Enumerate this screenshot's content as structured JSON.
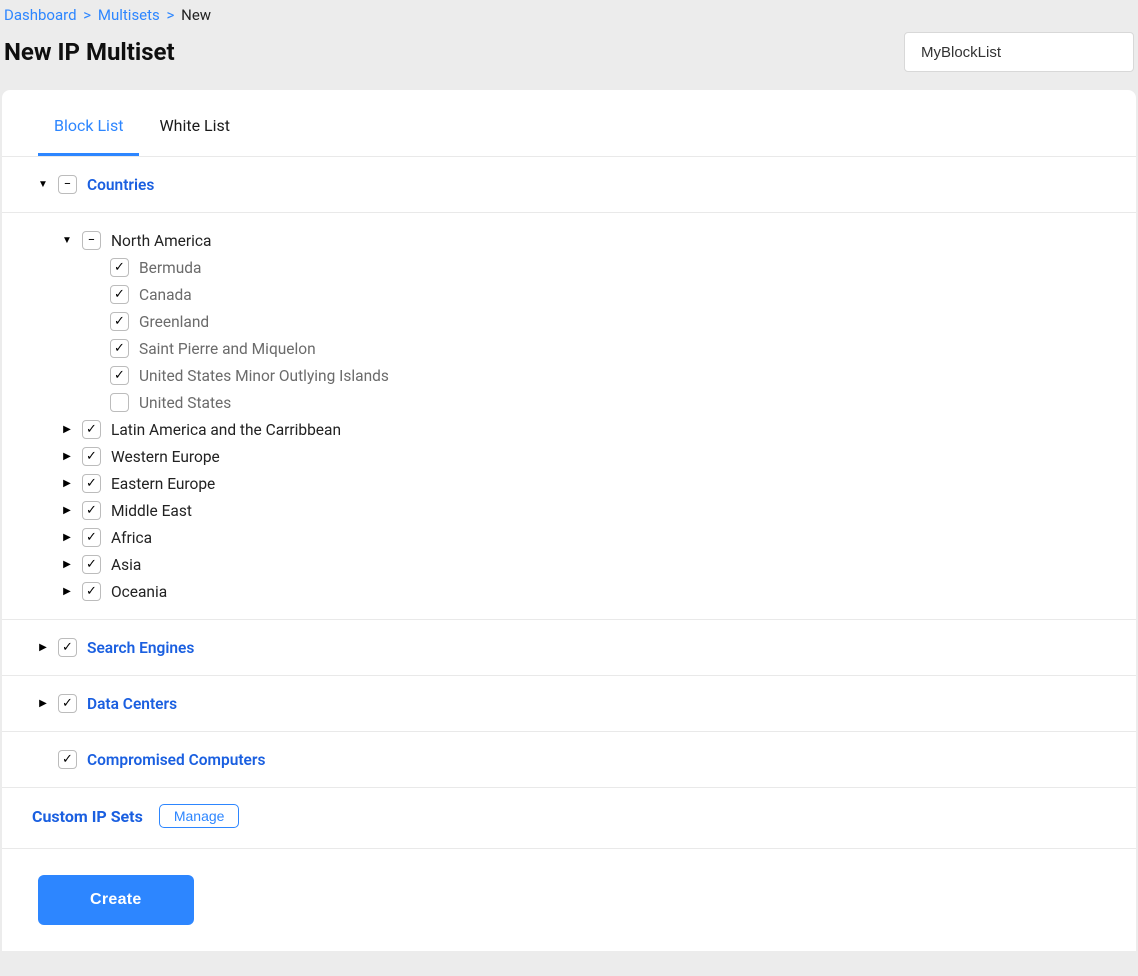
{
  "breadcrumb": {
    "items": [
      {
        "label": "Dashboard",
        "link": true
      },
      {
        "label": "Multisets",
        "link": true
      },
      {
        "label": "New",
        "link": false
      }
    ]
  },
  "page_title": "New IP Multiset",
  "name_input_value": "MyBlockList",
  "tabs": {
    "block": "Block List",
    "white": "White List"
  },
  "countries": {
    "label": "Countries",
    "north_america": {
      "label": "North America",
      "items": [
        {
          "label": "Bermuda",
          "checked": true
        },
        {
          "label": "Canada",
          "checked": true
        },
        {
          "label": "Greenland",
          "checked": true
        },
        {
          "label": "Saint Pierre and Miquelon",
          "checked": true
        },
        {
          "label": "United States Minor Outlying Islands",
          "checked": true
        },
        {
          "label": "United States",
          "checked": false
        }
      ]
    },
    "regions": [
      "Latin America and the Carribbean",
      "Western Europe",
      "Eastern Europe",
      "Middle East",
      "Africa",
      "Asia",
      "Oceania"
    ]
  },
  "search_engines_label": "Search Engines",
  "data_centers_label": "Data Centers",
  "compromised_label": "Compromised Computers",
  "custom_ip_sets": {
    "title": "Custom IP Sets",
    "manage": "Manage"
  },
  "create_label": "Create"
}
